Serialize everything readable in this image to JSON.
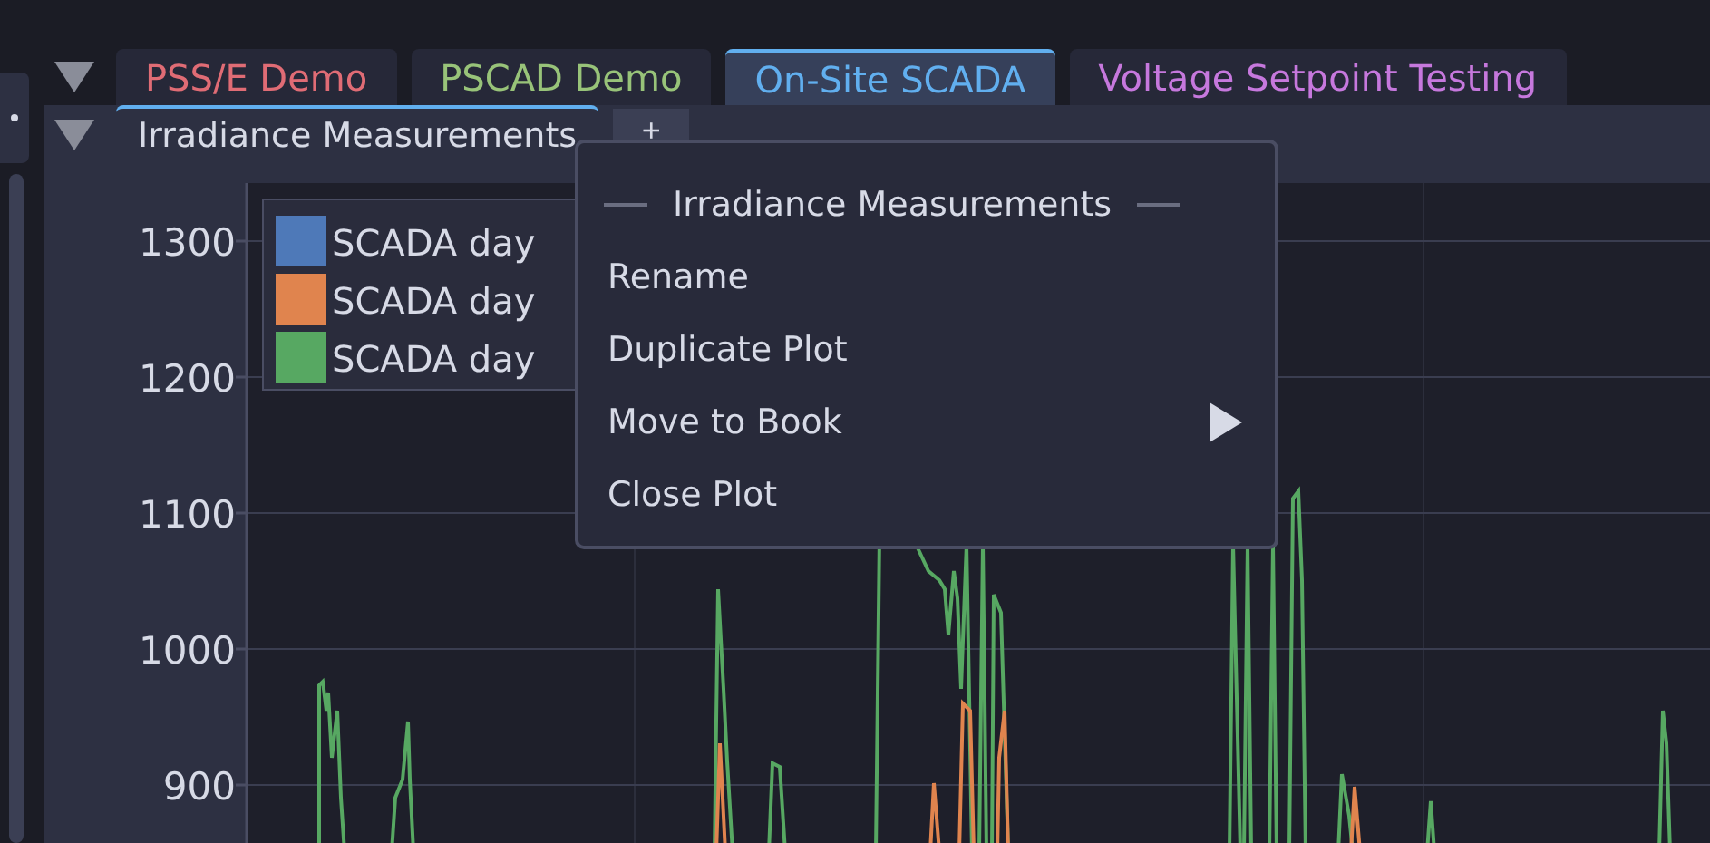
{
  "book_tabs": [
    {
      "label": "PSS/E Demo",
      "color": "#e06c75",
      "selected": false
    },
    {
      "label": "PSCAD Demo",
      "color": "#98c379",
      "selected": false
    },
    {
      "label": "On-Site SCADA",
      "color": "#61afef",
      "selected": true
    },
    {
      "label": "Voltage Setpoint Testing",
      "color": "#c678dd",
      "selected": false
    }
  ],
  "plot_tabs": [
    {
      "label": "Irradiance Measurements",
      "selected": true
    }
  ],
  "add_tab": "+",
  "plot": {
    "y_ticks": [
      "1300",
      "1200",
      "1100",
      "1000",
      "900"
    ],
    "legend": [
      {
        "label": "SCADA day",
        "color": "#4e79b8"
      },
      {
        "label": "SCADA day",
        "color": "#e0844e"
      },
      {
        "label": "SCADA day",
        "color": "#57a862"
      }
    ]
  },
  "context_menu": {
    "title": "Irradiance Measurements",
    "items": [
      {
        "label": "Rename",
        "submenu": false
      },
      {
        "label": "Duplicate Plot",
        "submenu": false
      },
      {
        "label": "Move to Book",
        "submenu": true
      },
      {
        "label": "Close Plot",
        "submenu": false
      }
    ]
  }
}
